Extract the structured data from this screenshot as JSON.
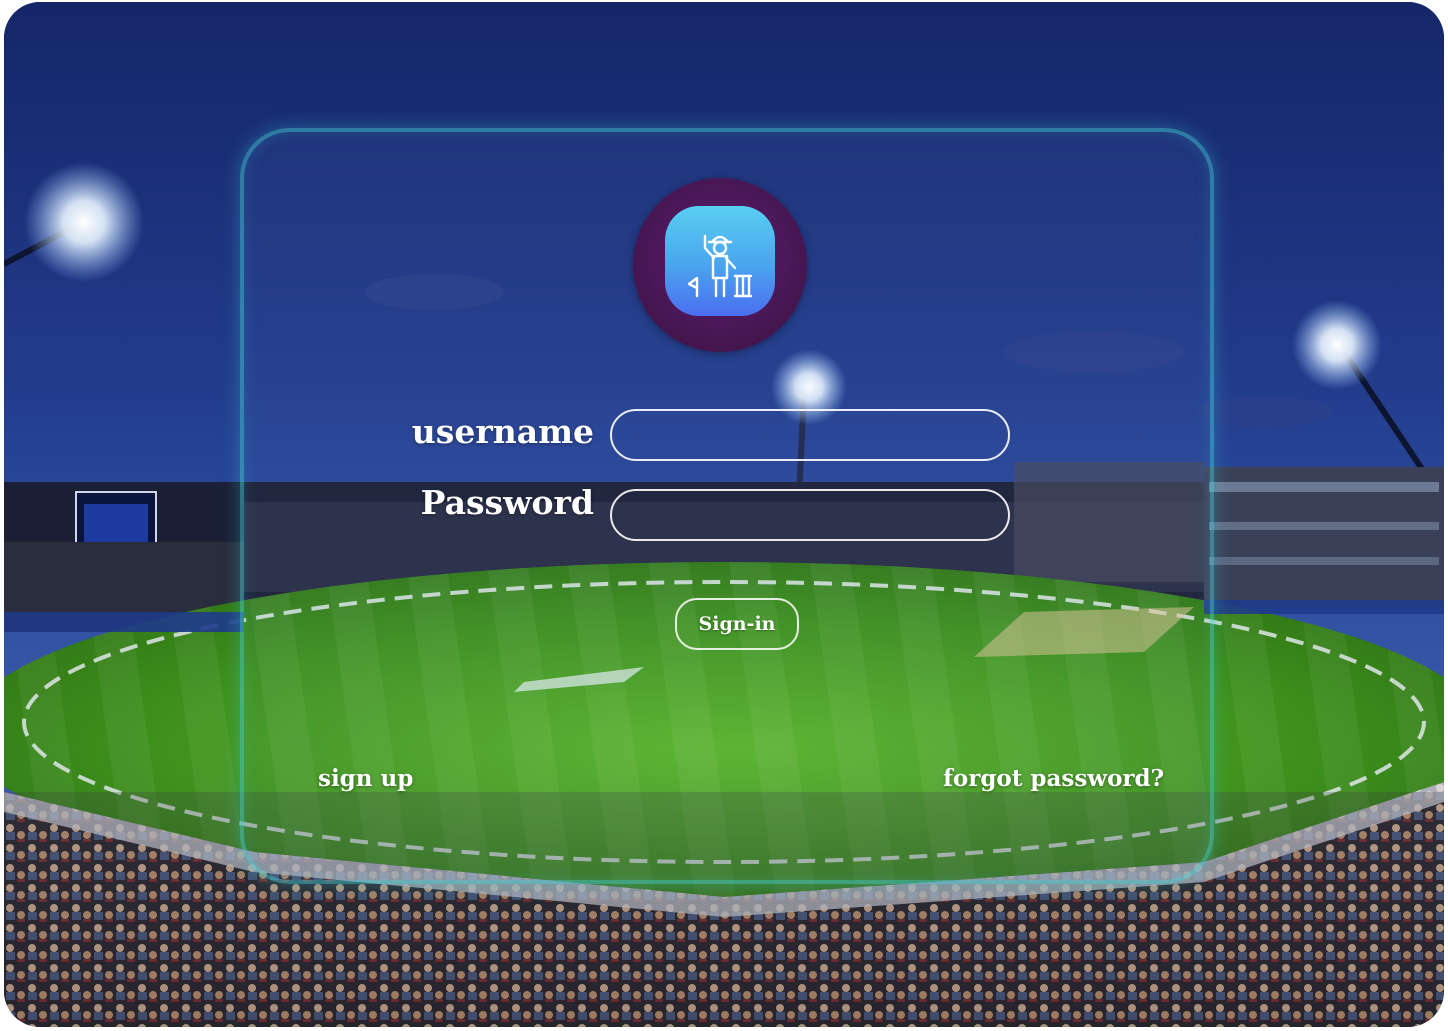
{
  "form": {
    "username_label": "username",
    "password_label": "Password",
    "username_value": "",
    "password_value": "",
    "signin_label": "Sign-in",
    "signup_label": "sign up",
    "forgot_label": "forgot password?"
  },
  "logo": {
    "icon": "cricket-umpire-icon",
    "outer_color": "#45154f",
    "inner_gradient_top": "#58d0f2",
    "inner_gradient_bottom": "#4a6ef0"
  },
  "background": {
    "scene": "cricket-stadium-night",
    "sky_color": "#1b2f78",
    "pitch_color": "#3f8f1f"
  },
  "colors": {
    "panel_border": "#40d2d7",
    "text": "#ffffff"
  }
}
